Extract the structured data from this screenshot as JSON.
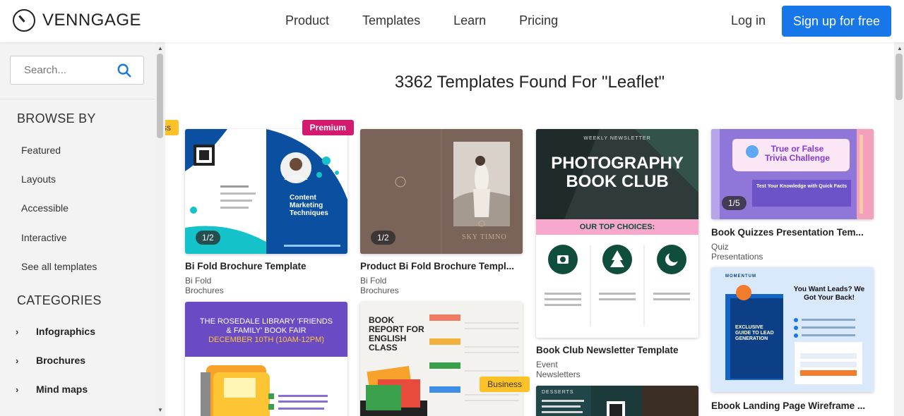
{
  "header": {
    "logo_text": "VENNGAGE",
    "nav": [
      "Product",
      "Templates",
      "Learn",
      "Pricing"
    ],
    "login": "Log in",
    "signup": "Sign up for free"
  },
  "sidebar": {
    "search_placeholder": "Search...",
    "browse_title": "BROWSE BY",
    "browse_items": [
      "Featured",
      "Layouts",
      "Accessible",
      "Interactive",
      "See all templates"
    ],
    "categories_title": "CATEGORIES",
    "categories": [
      "Infographics",
      "Brochures",
      "Mind maps"
    ]
  },
  "main": {
    "heading": "3362 Templates Found For \"Leaflet\"",
    "cards": [
      {
        "title": "Bi Fold Brochure Template",
        "subtitle": "Bi Fold Brochures",
        "badge": "Business",
        "pager": "1/2",
        "thumb_text": "Content Marketing Techniques"
      },
      {
        "title": "Product Bi Fold Brochure Templ...",
        "subtitle": "Bi Fold Brochures",
        "badge": "Premium",
        "pager": "1/2",
        "thumb_text": "SKY TIMNO"
      },
      {
        "title": "Book Club Newsletter Template",
        "subtitle": "Event Newsletters",
        "badge": "",
        "pager": "",
        "thumb_text": "PHOTOGRAPHY BOOK CLUB",
        "thumb_kicker": "WEEKLY NEWSLETTER",
        "thumb_sub": "OUR TOP CHOICES:"
      },
      {
        "title": "Book Quizzes Presentation Tem...",
        "subtitle": "Quiz Presentations",
        "badge": "",
        "pager": "1/5",
        "thumb_text": "True or False Trivia Challenge",
        "thumb_sub": "Test Your Knowledge with Quick Facts"
      },
      {
        "title": "",
        "subtitle": "",
        "badge": "",
        "pager": "",
        "thumb_text": "THE ROSEDALE LIBRARY 'FRIENDS & FAMILY' BOOK FAIR",
        "thumb_sub": "DECEMBER 10TH (10AM-12PM)"
      },
      {
        "title": "",
        "subtitle": "",
        "badge": "",
        "pager": "",
        "thumb_text": "BOOK REPORT FOR ENGLISH CLASS"
      },
      {
        "title": "Ebook Landing Page Wireframe ...",
        "subtitle": "",
        "badge": "",
        "pager": "",
        "thumb_text": "EXCLUSIVE GUIDE TO LEAD GENERATION",
        "thumb_sub": "You Want Leads? We Got Your Back!",
        "thumb_kicker": "MOMENTUM"
      },
      {
        "title": "",
        "subtitle": "",
        "badge": "Business",
        "pager": "",
        "thumb_text": "DESSERTS"
      }
    ]
  },
  "colors": {
    "accent": "#1877e8",
    "business": "#fdc227",
    "premium": "#d31a6f"
  }
}
